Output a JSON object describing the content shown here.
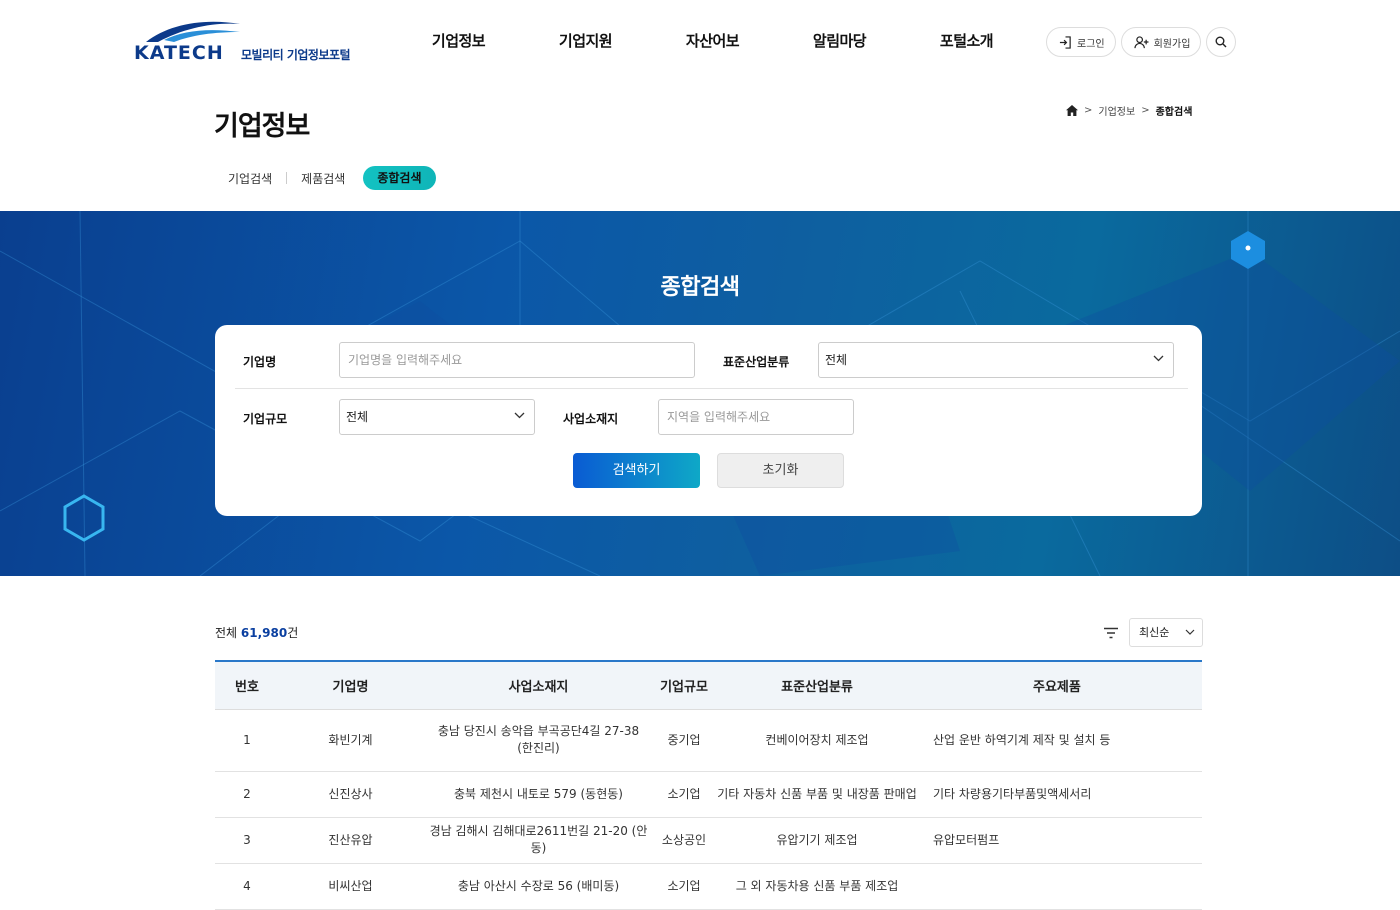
{
  "header": {
    "logo_text": "KATECH",
    "logo_sub": "모빌리티 기업정보포털",
    "nav": [
      "기업정보",
      "기업지원",
      "자산어보",
      "알림마당",
      "포털소개"
    ],
    "login_label": "로그인",
    "signup_label": "회원가입"
  },
  "page": {
    "title": "기업정보",
    "breadcrumb": [
      "기업정보",
      "종합검색"
    ],
    "tabs": [
      "기업검색",
      "제품검색",
      "종합검색"
    ],
    "active_tab": "종합검색"
  },
  "search": {
    "title": "종합검색",
    "company_label": "기업명",
    "company_placeholder": "기업명을 입력해주세요",
    "industry_label": "표준산업분류",
    "industry_value": "전체",
    "size_label": "기업규모",
    "size_value": "전체",
    "location_label": "사업소재지",
    "location_placeholder": "지역을 입력해주세요",
    "search_button": "검색하기",
    "reset_button": "초기화"
  },
  "results": {
    "total_prefix": "전체",
    "total_count": "61,980",
    "total_suffix": "건",
    "sort_value": "최신순",
    "columns": [
      "번호",
      "기업명",
      "사업소재지",
      "기업규모",
      "표준산업분류",
      "주요제품"
    ],
    "rows": [
      {
        "no": "1",
        "name": "화빈기계",
        "address": "충남 당진시 송악읍 부곡공단4길 27-38",
        "address2": "(한진리)",
        "size": "중기업",
        "industry": "컨베이어장치 제조업",
        "product": "산업 운반 하역기계 제작 및 설치 등"
      },
      {
        "no": "2",
        "name": "신진상사",
        "address": "충북 제천시 내토로 579 (동현동)",
        "address2": "",
        "size": "소기업",
        "industry": "기타 자동차 신품 부품 및 내장품 판매업",
        "product": "기타 차량용기타부품및액세서리"
      },
      {
        "no": "3",
        "name": "진산유압",
        "address": "경남 김해시 김해대로2611번길 21-20 (안동)",
        "address2": "",
        "size": "소상공인",
        "industry": "유압기기 제조업",
        "product": "유압모터펌프"
      },
      {
        "no": "4",
        "name": "비씨산업",
        "address": "충남 아산시 수장로 56 (배미동)",
        "address2": "",
        "size": "소기업",
        "industry": "그 외 자동차용 신품 부품 제조업",
        "product": ""
      }
    ]
  },
  "colors": {
    "brand": "#0c3a8a",
    "accent": "#13c2c2",
    "banner": "#0b57a8",
    "table_top": "#2a78c9"
  }
}
